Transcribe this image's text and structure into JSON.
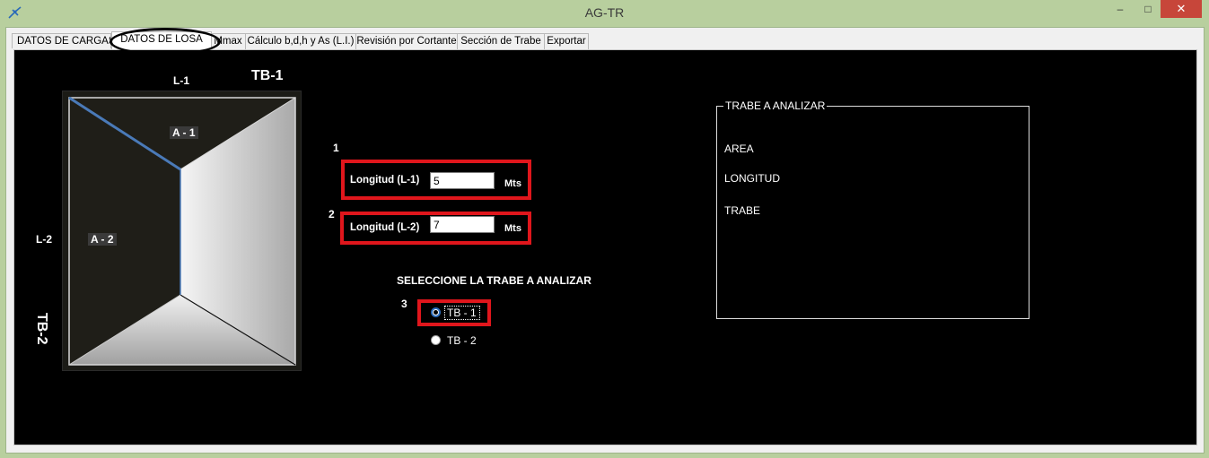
{
  "window": {
    "title": "AG-TR",
    "minimize": "–",
    "maximize": "□",
    "close": "✕"
  },
  "tabs": [
    {
      "label": "DATOS DE CARGAS",
      "active": false
    },
    {
      "label": "DATOS DE LOSA",
      "active": true
    },
    {
      "label": "Mmax",
      "active": false
    },
    {
      "label": "Cálculo b,d,h y As (L.I.)",
      "active": false
    },
    {
      "label": "Revisión por Cortante",
      "active": false
    },
    {
      "label": "Sección de Trabe",
      "active": false
    },
    {
      "label": "Exportar",
      "active": false
    }
  ],
  "slab": {
    "l1_label": "L-1",
    "l2_label": "L-2",
    "tb1_label": "TB-1",
    "tb2_label": "TB-2",
    "area1_label": "A - 1",
    "area2_label": "A - 2"
  },
  "form": {
    "step1": "1",
    "step2": "2",
    "step3": "3",
    "l1_field_label": "Longitud (L-1)",
    "l1_value": "5",
    "l1_unit": "Mts",
    "l2_field_label": "Longitud (L-2)",
    "l2_value": "7",
    "l2_unit": "Mts",
    "select_heading": "SELECCIONE LA TRABE A ANALIZAR",
    "radio_tb1": "TB - 1",
    "radio_tb2": "TB - 2",
    "selected": "TB - 1"
  },
  "analysis": {
    "group_title": "TRABE A ANALIZAR",
    "area_label": "AREA",
    "longitud_label": "LONGITUD",
    "trabe_label": "TRABE"
  },
  "colors": {
    "highlight_red": "#e0161c",
    "panel_bg": "#000000",
    "beam_line": "#4a7ab8"
  }
}
